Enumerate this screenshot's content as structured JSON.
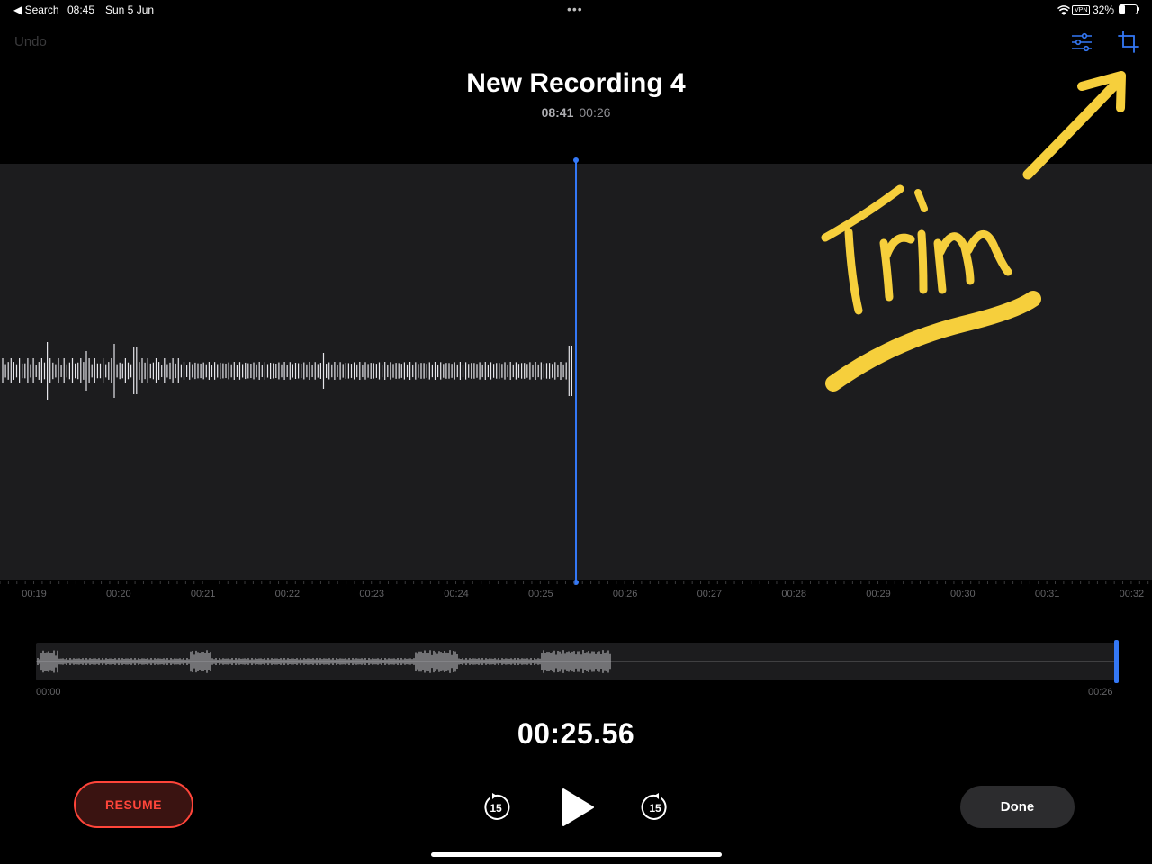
{
  "status_bar": {
    "back_app": "◀ Search",
    "time": "08:45",
    "date": "Sun 5 Jun",
    "vpn": "VPN",
    "battery": "32%",
    "battery_level": 0.32
  },
  "toolbar": {
    "undo_label": "Undo",
    "icons": [
      "sliders-icon",
      "crop-trim-icon"
    ]
  },
  "recording": {
    "title": "New Recording 4",
    "time_of_day": "08:41",
    "duration": "00:26"
  },
  "timeline": {
    "labels": [
      "00:19",
      "00:20",
      "00:21",
      "00:22",
      "00:23",
      "00:24",
      "00:25",
      "00:26",
      "00:27",
      "00:28",
      "00:29",
      "00:30",
      "00:31",
      "00:32"
    ]
  },
  "overview": {
    "start_label": "00:00",
    "end_label": "00:26"
  },
  "playback": {
    "elapsed": "00:25.56",
    "skip_back_label": "15",
    "skip_forward_label": "15"
  },
  "buttons": {
    "resume": "RESUME",
    "done": "Done"
  },
  "annotation": {
    "text": "Trim"
  },
  "colors": {
    "accent": "#3478f6",
    "record_red": "#ff453a",
    "annotation_yellow": "#f6cf3c",
    "panel": "#1c1c1e"
  }
}
